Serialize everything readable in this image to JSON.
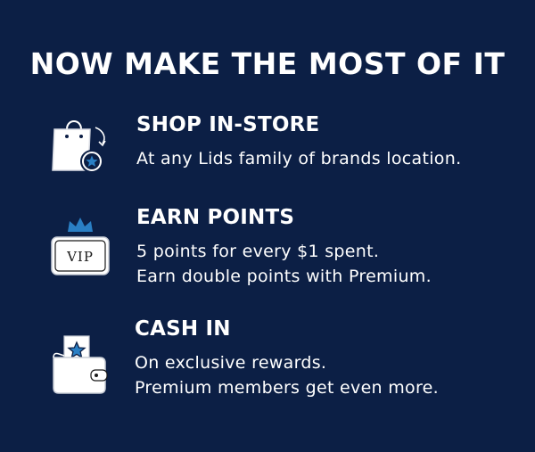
{
  "colors": {
    "background": "#0c1f45",
    "text": "#ffffff",
    "accent_blue": "#2a7fc4"
  },
  "headline": "NOW MAKE THE MOST OF IT",
  "steps": [
    {
      "icon": "shopping-bag-star-icon",
      "title": "SHOP IN-STORE",
      "lines": [
        "At any Lids family of brands location."
      ]
    },
    {
      "icon": "vip-crown-card-icon",
      "title": "EARN POINTS",
      "lines": [
        "5 points for every $1 spent.",
        "Earn double points with Premium."
      ]
    },
    {
      "icon": "wallet-star-icon",
      "title": "CASH IN",
      "lines": [
        "On exclusive rewards.",
        "Premium members get even more."
      ]
    }
  ],
  "vip_card_text": "VIP"
}
